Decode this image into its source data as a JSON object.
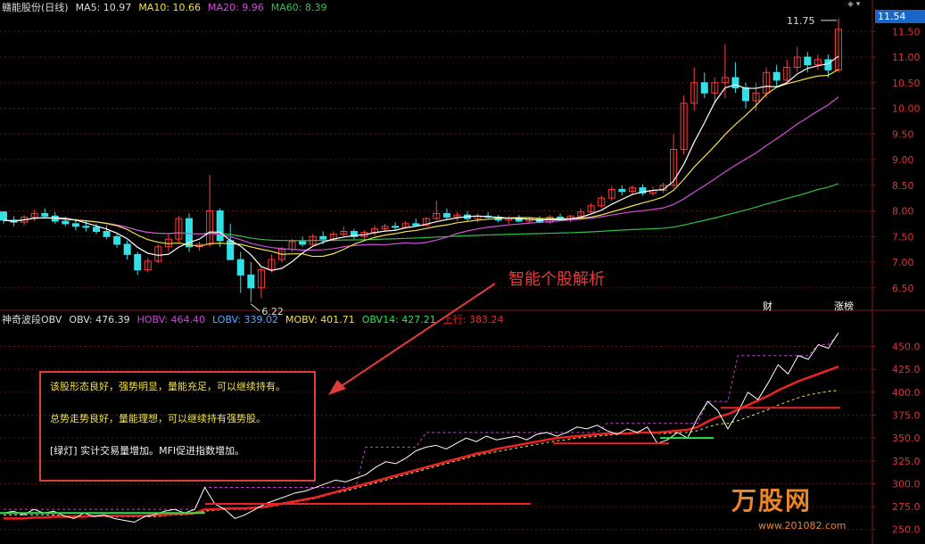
{
  "window": {
    "title": "赣能股份(日线)",
    "ctrl_glyphs": "◈ ▾"
  },
  "price_panel": {
    "legend": {
      "ma5": "MA5: 10.97",
      "ma10": "MA10: 10.66",
      "ma20": "MA20: 9.96",
      "ma60": "MA60: 8.39"
    },
    "current_price": "11.54",
    "high_label": "11.75",
    "low_label": "6.22",
    "y_ticks": [
      "11.50",
      "11.00",
      "10.50",
      "10.00",
      "9.50",
      "9.00",
      "8.50",
      "8.00",
      "7.50",
      "7.00",
      "6.50"
    ],
    "tags": {
      "cai": "财",
      "zhangbang": "涨榜"
    },
    "colors": {
      "up": "#ff3b3b",
      "down": "#33e0e6",
      "ma5": "#ffffff",
      "ma10": "#f2e14a",
      "ma20": "#d14fd9",
      "ma60": "#2ec24a"
    }
  },
  "indicator_panel": {
    "legend": {
      "name": "神奇波段OBV",
      "obv": "OBV: 476.39",
      "hobv": "HOBV: 464.40",
      "lobv": "LOBV: 339.02",
      "mobv": "MOBV: 401.71",
      "obv14": "OBV14: 427.21",
      "up": "上行: 383.24"
    },
    "y_ticks": [
      "450.0",
      "425.0",
      "400.0",
      "375.0",
      "350.0",
      "325.0",
      "300.0",
      "275.0",
      "250.0"
    ],
    "colors": {
      "obv": "#ffffff",
      "hobv": "#c64ad6",
      "lobv": "#5ea6ff",
      "mobv": "#f2e14a",
      "obv14": "#e22",
      "up": "#e22",
      "green": "#2ee24a"
    }
  },
  "annotation": {
    "callout": "智能个股解析",
    "line1": "该股形态良好，强势明显，量能充足，可以继续持有。",
    "line2": "总势走势良好，量能理想，可以继续持有强势股。",
    "line3": "[绿灯] 实计交易量增加。MFI促进指数增加。"
  },
  "watermark": {
    "brand": "万股网",
    "url": "www.201082.com"
  },
  "chart_data": [
    {
      "type": "candlestick",
      "title": "赣能股份(日线)",
      "y_range": [
        6.2,
        11.8
      ],
      "ohlc": [
        [
          7.98,
          8.0,
          7.75,
          7.82
        ],
        [
          7.82,
          7.9,
          7.7,
          7.78
        ],
        [
          7.78,
          7.92,
          7.72,
          7.88
        ],
        [
          7.88,
          8.02,
          7.8,
          7.95
        ],
        [
          7.95,
          8.05,
          7.85,
          7.9
        ],
        [
          7.9,
          7.98,
          7.75,
          7.8
        ],
        [
          7.8,
          7.88,
          7.7,
          7.75
        ],
        [
          7.75,
          7.85,
          7.62,
          7.7
        ],
        [
          7.7,
          7.8,
          7.6,
          7.68
        ],
        [
          7.68,
          7.75,
          7.55,
          7.6
        ],
        [
          7.6,
          7.72,
          7.45,
          7.5
        ],
        [
          7.5,
          7.55,
          7.28,
          7.35
        ],
        [
          7.35,
          7.42,
          7.05,
          7.15
        ],
        [
          7.15,
          7.2,
          6.75,
          6.85
        ],
        [
          6.85,
          7.08,
          6.8,
          7.02
        ],
        [
          7.02,
          7.35,
          6.98,
          7.3
        ],
        [
          7.3,
          7.55,
          7.2,
          7.45
        ],
        [
          7.45,
          7.9,
          7.4,
          7.85
        ],
        [
          7.85,
          7.95,
          7.2,
          7.3
        ],
        [
          7.3,
          7.4,
          7.22,
          7.35
        ],
        [
          7.35,
          8.7,
          7.3,
          8.0
        ],
        [
          8.0,
          8.05,
          7.3,
          7.42
        ],
        [
          7.42,
          7.75,
          7.1,
          7.05
        ],
        [
          7.05,
          7.2,
          6.4,
          6.75
        ],
        [
          6.75,
          7.0,
          6.22,
          6.5
        ],
        [
          6.5,
          6.9,
          6.3,
          6.85
        ],
        [
          6.85,
          7.15,
          6.8,
          7.05
        ],
        [
          7.05,
          7.3,
          7.0,
          7.25
        ],
        [
          7.25,
          7.45,
          7.2,
          7.4
        ],
        [
          7.4,
          7.5,
          7.3,
          7.35
        ],
        [
          7.35,
          7.55,
          7.3,
          7.5
        ],
        [
          7.5,
          7.6,
          7.35,
          7.45
        ],
        [
          7.45,
          7.6,
          7.4,
          7.55
        ],
        [
          7.55,
          7.7,
          7.5,
          7.6
        ],
        [
          7.6,
          7.65,
          7.45,
          7.5
        ],
        [
          7.5,
          7.62,
          7.45,
          7.58
        ],
        [
          7.58,
          7.72,
          7.52,
          7.65
        ],
        [
          7.65,
          7.75,
          7.6,
          7.7
        ],
        [
          7.7,
          7.78,
          7.62,
          7.68
        ],
        [
          7.68,
          7.8,
          7.65,
          7.75
        ],
        [
          7.75,
          7.85,
          7.7,
          7.72
        ],
        [
          7.72,
          7.88,
          7.7,
          7.85
        ],
        [
          7.85,
          8.2,
          7.82,
          7.95
        ],
        [
          7.95,
          8.05,
          7.82,
          7.88
        ],
        [
          7.88,
          7.98,
          7.8,
          7.92
        ],
        [
          7.92,
          8.0,
          7.8,
          7.85
        ],
        [
          7.85,
          7.95,
          7.78,
          7.9
        ],
        [
          7.9,
          7.98,
          7.85,
          7.88
        ],
        [
          7.88,
          7.92,
          7.78,
          7.82
        ],
        [
          7.82,
          7.9,
          7.75,
          7.85
        ],
        [
          7.85,
          7.92,
          7.78,
          7.8
        ],
        [
          7.8,
          7.88,
          7.75,
          7.84
        ],
        [
          7.84,
          7.9,
          7.76,
          7.78
        ],
        [
          7.78,
          7.92,
          7.75,
          7.88
        ],
        [
          7.88,
          7.95,
          7.8,
          7.84
        ],
        [
          7.84,
          7.92,
          7.78,
          7.9
        ],
        [
          7.9,
          8.05,
          7.85,
          7.98
        ],
        [
          7.98,
          8.15,
          7.95,
          8.1
        ],
        [
          8.1,
          8.3,
          8.05,
          8.25
        ],
        [
          8.25,
          8.48,
          8.2,
          8.42
        ],
        [
          8.42,
          8.5,
          8.3,
          8.38
        ],
        [
          8.38,
          8.5,
          8.32,
          8.45
        ],
        [
          8.45,
          8.52,
          8.3,
          8.35
        ],
        [
          8.35,
          8.48,
          8.3,
          8.4
        ],
        [
          8.4,
          8.55,
          8.35,
          8.5
        ],
        [
          8.5,
          9.5,
          8.45,
          9.2
        ],
        [
          9.2,
          10.25,
          9.1,
          10.1
        ],
        [
          10.1,
          10.8,
          9.95,
          10.5
        ],
        [
          10.5,
          10.7,
          10.2,
          10.3
        ],
        [
          10.3,
          10.6,
          10.1,
          10.5
        ],
        [
          10.5,
          11.25,
          10.2,
          10.6
        ],
        [
          10.6,
          10.9,
          10.3,
          10.4
        ],
        [
          10.4,
          10.5,
          10.0,
          10.15
        ],
        [
          10.15,
          10.5,
          9.95,
          10.3
        ],
        [
          10.3,
          10.8,
          10.2,
          10.7
        ],
        [
          10.7,
          10.85,
          10.4,
          10.55
        ],
        [
          10.55,
          10.95,
          10.5,
          10.8
        ],
        [
          10.8,
          11.2,
          10.7,
          11.0
        ],
        [
          11.0,
          11.1,
          10.7,
          10.85
        ],
        [
          10.85,
          11.05,
          10.75,
          10.95
        ],
        [
          10.95,
          11.05,
          10.6,
          10.75
        ],
        [
          10.75,
          11.75,
          10.7,
          11.54
        ]
      ]
    },
    {
      "type": "line",
      "title": "神奇波段OBV",
      "y_range": [
        240,
        470
      ],
      "series": [
        {
          "name": "OBV",
          "values": [
            268,
            270,
            266,
            272,
            268,
            270,
            265,
            262,
            268,
            264,
            266,
            262,
            260,
            258,
            264,
            266,
            270,
            272,
            268,
            272,
            296,
            278,
            272,
            262,
            266,
            272,
            278,
            282,
            286,
            290,
            292,
            296,
            300,
            304,
            302,
            306,
            310,
            318,
            324,
            322,
            328,
            336,
            340,
            342,
            338,
            344,
            350,
            346,
            352,
            348,
            350,
            352,
            348,
            354,
            356,
            352,
            356,
            362,
            360,
            364,
            358,
            354,
            360,
            356,
            362,
            344,
            348,
            356,
            350,
            372,
            390,
            380,
            360,
            378,
            400,
            392,
            410,
            430,
            420,
            440,
            436,
            452,
            448,
            465
          ]
        },
        {
          "name": "HOBV",
          "values": [
            272,
            272,
            272,
            272,
            272,
            272,
            272,
            272,
            272,
            272,
            272,
            272,
            272,
            272,
            272,
            272,
            272,
            272,
            272,
            272,
            296,
            296,
            296,
            296,
            296,
            296,
            296,
            296,
            296,
            296,
            296,
            296,
            296,
            296,
            296,
            296,
            340,
            340,
            340,
            340,
            340,
            340,
            356,
            356,
            356,
            356,
            356,
            356,
            356,
            356,
            356,
            356,
            356,
            356,
            356,
            356,
            356,
            356,
            356,
            356,
            366,
            366,
            366,
            366,
            366,
            366,
            366,
            366,
            366,
            366,
            390,
            390,
            390,
            440,
            440,
            440,
            440,
            440,
            440,
            440,
            440,
            452,
            452,
            464
          ]
        },
        {
          "name": "MOBV",
          "values": [
            266,
            266,
            266,
            266,
            266,
            266,
            265,
            265,
            265,
            265,
            264,
            264,
            264,
            264,
            264,
            264,
            265,
            266,
            266,
            267,
            270,
            271,
            272,
            272,
            272,
            273,
            274,
            276,
            278,
            280,
            282,
            284,
            287,
            290,
            292,
            295,
            298,
            301,
            304,
            307,
            310,
            313,
            316,
            319,
            322,
            325,
            328,
            331,
            333,
            335,
            337,
            339,
            341,
            343,
            345,
            347,
            348,
            350,
            351,
            352,
            353,
            354,
            355,
            355,
            356,
            355,
            355,
            356,
            356,
            358,
            362,
            365,
            366,
            369,
            373,
            377,
            381,
            386,
            390,
            394,
            397,
            399,
            401,
            402
          ]
        },
        {
          "name": "OBV14",
          "values": [
            262,
            262,
            262,
            263,
            263,
            264,
            264,
            264,
            264,
            265,
            265,
            265,
            265,
            265,
            265,
            266,
            266,
            267,
            267,
            268,
            272,
            272,
            273,
            273,
            273,
            274,
            275,
            277,
            279,
            281,
            283,
            285,
            288,
            291,
            294,
            297,
            300,
            303,
            306,
            309,
            312,
            315,
            318,
            321,
            324,
            327,
            330,
            333,
            335,
            338,
            340,
            342,
            344,
            346,
            348,
            350,
            351,
            352,
            353,
            354,
            355,
            355,
            355,
            356,
            356,
            356,
            357,
            358,
            359,
            362,
            368,
            373,
            376,
            381,
            386,
            391,
            396,
            402,
            407,
            412,
            416,
            420,
            424,
            428
          ]
        }
      ]
    }
  ]
}
